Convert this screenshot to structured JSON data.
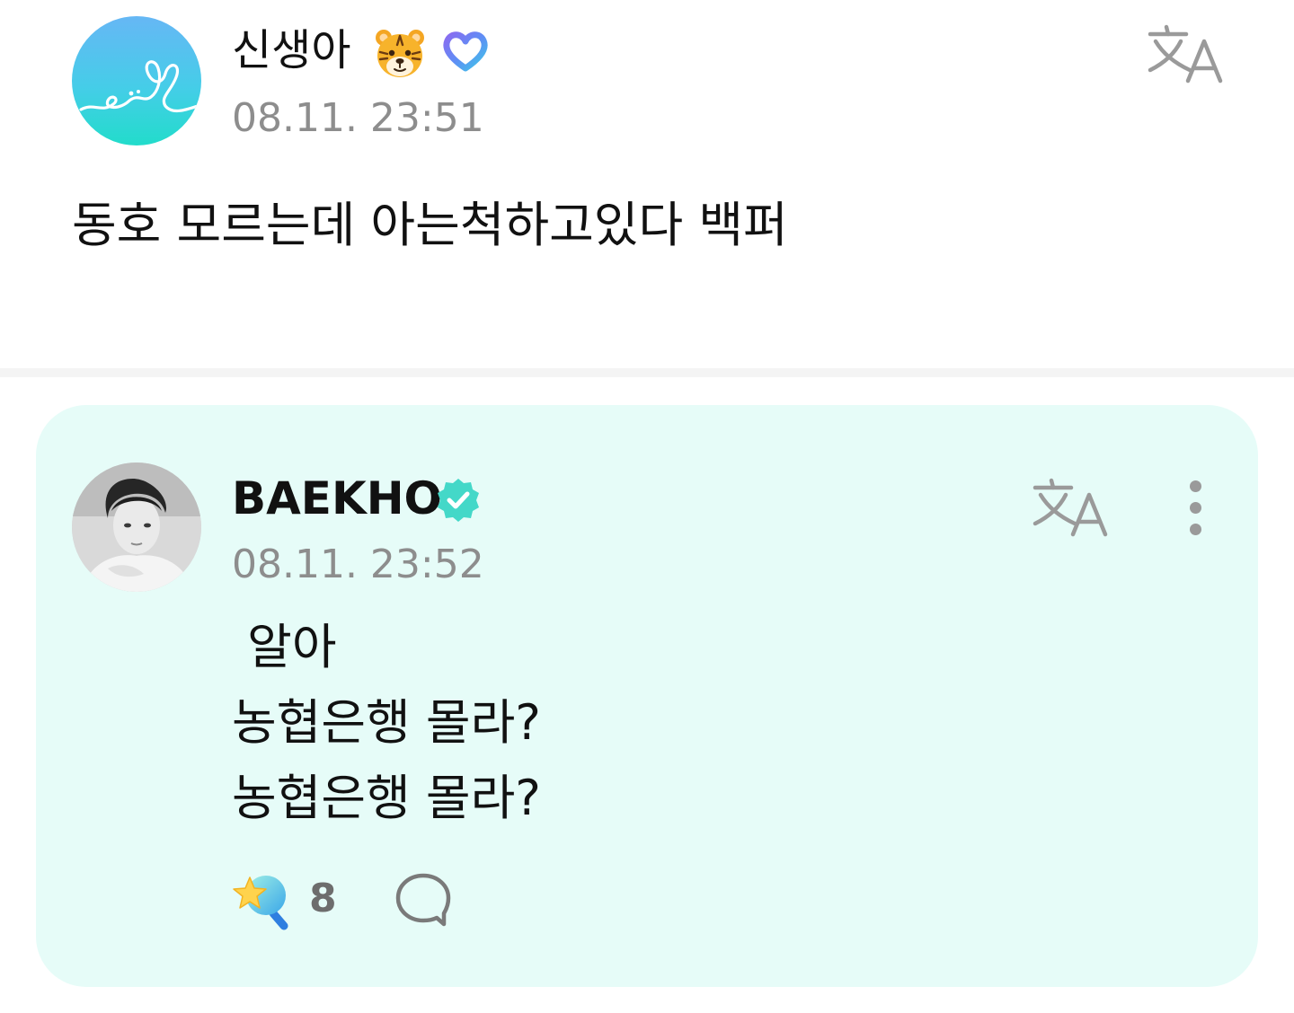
{
  "post": {
    "author": {
      "name": "신생아",
      "avatar_icon": "heart-scribble-avatar",
      "badges": [
        "tiger-face-emoji",
        "purple-heart-badge"
      ]
    },
    "timestamp": "08.11. 23:51",
    "body": "동호 모르는데 아는척하고있다 백퍼",
    "translate_icon": "translate-icon"
  },
  "comment": {
    "author": {
      "name": "BAEKHO",
      "avatar_icon": "artist-photo-avatar",
      "verified_icon": "verified-icon"
    },
    "timestamp": "08.11. 23:52",
    "body_lines": [
      " 알아",
      "농협은행 몰라?",
      "농협은행 몰라?"
    ],
    "translate_icon": "translate-icon",
    "more_icon": "more-vertical-icon",
    "reactions": {
      "like_icon": "lightstick-star-icon",
      "like_count": "8",
      "reply_icon": "speech-bubble-icon"
    }
  },
  "colors": {
    "card_background": "#e6fcf8",
    "accent": "#44d8c8",
    "timestamp_gray": "#8d8d8d",
    "icon_gray": "#9a9a9a"
  }
}
